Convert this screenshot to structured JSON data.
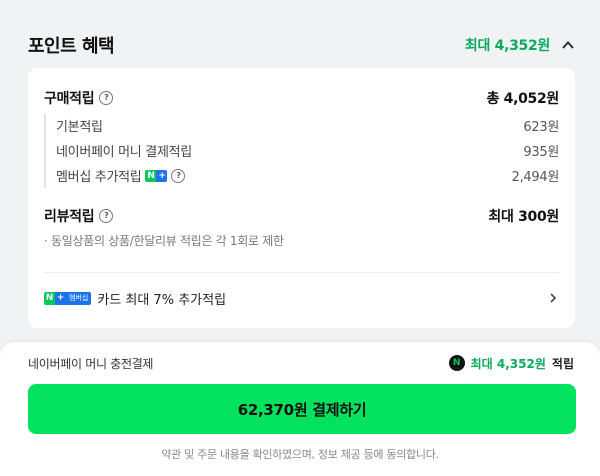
{
  "header": {
    "title": "포인트 혜택",
    "max_label": "최대 4,352원"
  },
  "purchase": {
    "label": "구매적립",
    "total": "총 4,052원",
    "items": [
      {
        "label": "기본적립",
        "value": "623원"
      },
      {
        "label": "네이버페이 머니 결제적립",
        "value": "935원"
      },
      {
        "label": "멤버십 추가적립",
        "value": "2,494원",
        "badge_n": "N",
        "badge_plus": "+"
      }
    ]
  },
  "review": {
    "label": "리뷰적립",
    "value": "최대 300원",
    "note": "· 동일상품의 상품/한달리뷰 적립은 각 1회로 제한"
  },
  "card_row": {
    "badge_n": "N",
    "badge_plus": "+",
    "badge_text": "멤버십",
    "label": "카드 최대 7% 추가적립"
  },
  "payment": {
    "label": "네이버페이 머니 충전결제",
    "icon_text": "N",
    "max": "최대 4,352원",
    "suffix": "적립"
  },
  "cta": {
    "label": "62,370원 결제하기"
  },
  "terms": "약관 및 주문 내용을 확인하였으며, 정보 제공 등에 동의합니다.",
  "colors": {
    "accent_green": "#09aa5c",
    "button_green": "#03e25f",
    "membership_blue": "#1a73e8"
  },
  "icons": {
    "collapse": "chevron-up-icon",
    "help": "question-circle-icon",
    "navigate": "chevron-right-icon"
  }
}
